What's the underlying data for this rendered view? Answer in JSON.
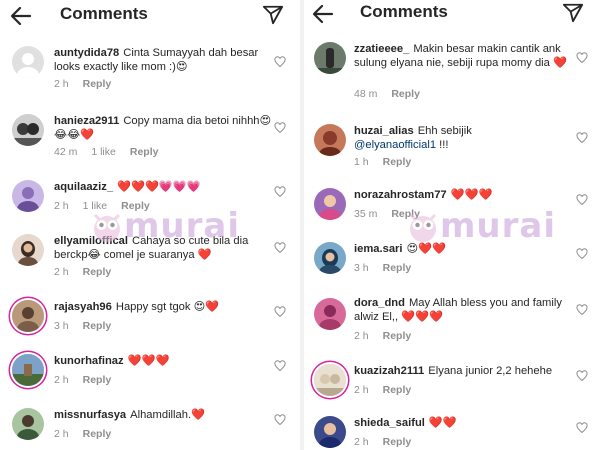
{
  "header": {
    "title": "Comments"
  },
  "watermark": {
    "text": "murai"
  },
  "left": {
    "comments": [
      {
        "username": "auntydida78",
        "text": "Cinta Sumayyah dah besar looks exactly like mom :)😍",
        "time": "2 h",
        "likes": "",
        "reply": "Reply"
      },
      {
        "username": "hanieza2911",
        "text": "Copy mama dia betoi nihhh😍😂😂❤️",
        "time": "42 m",
        "likes": "1 like",
        "reply": "Reply"
      },
      {
        "username": "aquilaaziz_",
        "text": "❤️❤️❤️💗💗💗",
        "time": "2 h",
        "likes": "1 like",
        "reply": "Reply"
      },
      {
        "username": "ellyamiloffical",
        "text": "Cahaya so cute bila dia berckp😂 comel je suaranya ❤️",
        "time": "2 h",
        "likes": "",
        "reply": "Reply"
      },
      {
        "username": "rajasyah96",
        "text": "Happy sgt tgok 😍❤️",
        "time": "3 h",
        "likes": "",
        "reply": "Reply"
      },
      {
        "username": "kunorhafinaz",
        "text": "❤️❤️❤️",
        "time": "2 h",
        "likes": "",
        "reply": "Reply"
      },
      {
        "username": "missnurfasya",
        "text": "Alhamdillah.❤️",
        "time": "2 h",
        "likes": "",
        "reply": "Reply"
      }
    ]
  },
  "right": {
    "comments": [
      {
        "username": "zzatieeee_",
        "text": "Makin besar makin cantik ank sulung elyana nie, sebiji rupa momy dia ❤️",
        "time": "48 m",
        "likes": "",
        "reply": "Reply"
      },
      {
        "username": "huzai_alias",
        "text": "Ehh sebijik",
        "mention": "@elyanaofficial1",
        "text_after": " !!!",
        "time": "1 h",
        "likes": "",
        "reply": "Reply"
      },
      {
        "username": "norazahrostam77",
        "text": "❤️❤️❤️",
        "time": "35 m",
        "likes": "",
        "reply": "Reply"
      },
      {
        "username": "iema.sari",
        "text": "😍❤️❤️",
        "time": "3 h",
        "likes": "",
        "reply": "Reply"
      },
      {
        "username": "dora_dnd",
        "text": "May Allah bless you and family alwiz El,, ❤️❤️❤️",
        "time": "2 h",
        "likes": "",
        "reply": "Reply"
      },
      {
        "username": "kuazizah2111",
        "text": "Elyana junior 2,2 hehehe",
        "time": "2 h",
        "likes": "",
        "reply": "Reply"
      },
      {
        "username": "shieda_saiful",
        "text": "❤️❤️",
        "time": "2 h",
        "likes": "",
        "reply": "Reply"
      }
    ]
  },
  "colors": {
    "text": "#262626",
    "meta": "#8e8e8e",
    "mention": "#00376b",
    "watermark": "#c49ad6",
    "story_ring": "#d6249f"
  }
}
